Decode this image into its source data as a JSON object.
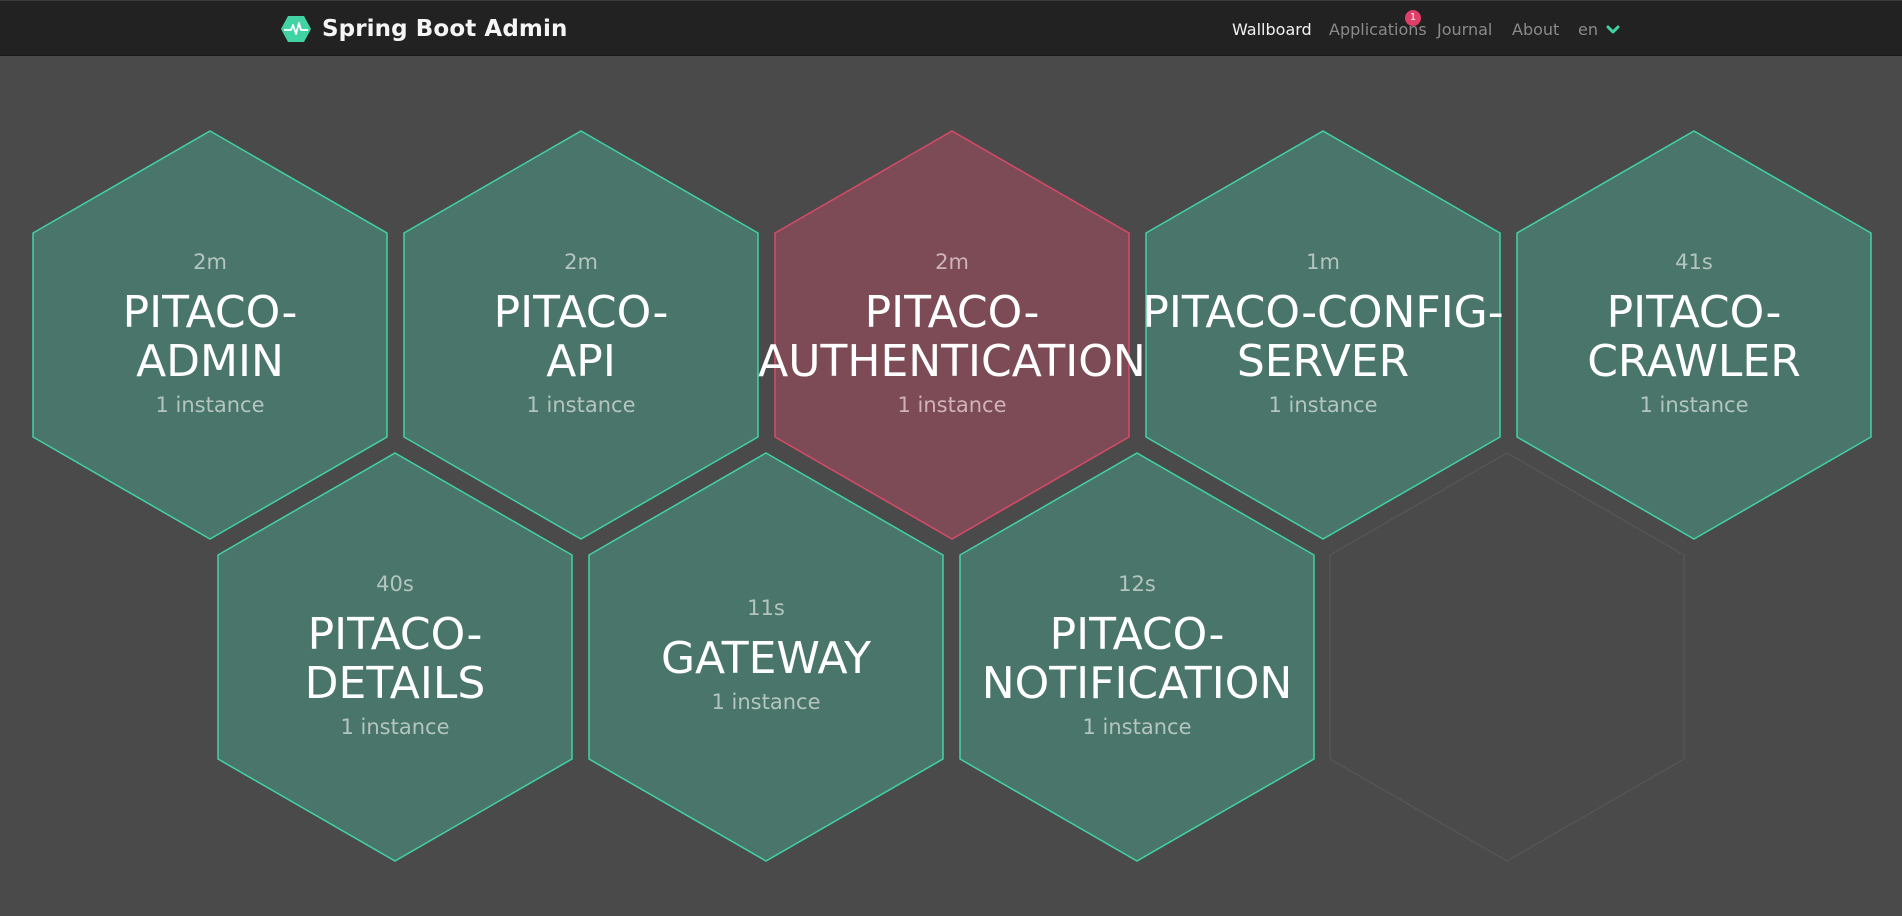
{
  "nav": {
    "brand": "Spring Boot Admin",
    "links": {
      "wallboard": "Wallboard",
      "applications": "Applications",
      "journal": "Journal",
      "about": "About"
    },
    "applications_badge": "1",
    "language": "en"
  },
  "colors": {
    "background": "#4a4a4a",
    "navbar": "#222222",
    "accent": "#42d3a5",
    "up_fill": "#49756a",
    "up_stroke": "#42d3a5",
    "down_fill": "#7d4b55",
    "down_stroke": "#d94a69",
    "empty_stroke": "#555555",
    "badge": "#e03e68"
  },
  "applications": [
    {
      "name": "PITACO-\nADMIN",
      "uptime": "2m",
      "instances": "1 instance",
      "status": "UP"
    },
    {
      "name": "PITACO-\nAPI",
      "uptime": "2m",
      "instances": "1 instance",
      "status": "UP"
    },
    {
      "name": "PITACO-\nAUTHENTICATION",
      "uptime": "2m",
      "instances": "1 instance",
      "status": "DOWN"
    },
    {
      "name": "PITACO-CONFIG-\nSERVER",
      "uptime": "1m",
      "instances": "1 instance",
      "status": "UP"
    },
    {
      "name": "PITACO-\nCRAWLER",
      "uptime": "41s",
      "instances": "1 instance",
      "status": "UP"
    },
    {
      "name": "PITACO-\nDETAILS",
      "uptime": "40s",
      "instances": "1 instance",
      "status": "UP"
    },
    {
      "name": "GATEWAY",
      "uptime": "11s",
      "instances": "1 instance",
      "status": "UP"
    },
    {
      "name": "PITACO-\nNOTIFICATION",
      "uptime": "12s",
      "instances": "1 instance",
      "status": "UP"
    }
  ]
}
